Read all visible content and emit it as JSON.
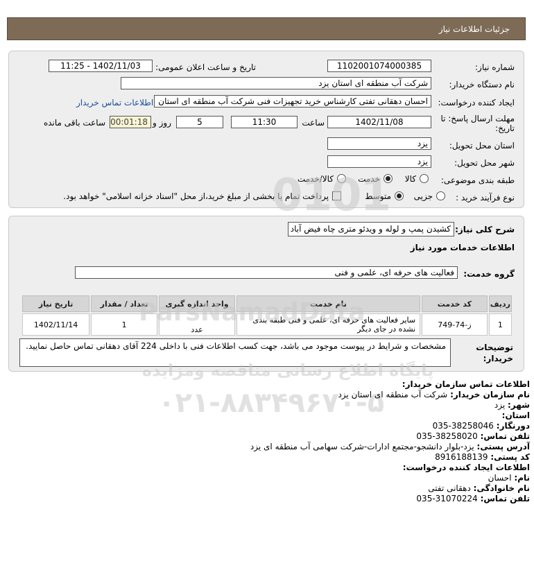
{
  "header": {
    "title": "جزئیات اطلاعات نیاز"
  },
  "need": {
    "number_label": "شماره نیاز:",
    "number": "1102001074000385",
    "announce_label": "تاریخ و ساعت اعلان عمومی:",
    "announce": "1402/11/03 - 11:25",
    "buyer_label": "نام دستگاه خریدار:",
    "buyer": "شرکت آب منطقه ای استان یزد",
    "creator_label": "ایجاد کننده درخواست:",
    "creator": "احسان دهقانی تفتی کارشناس خرید تجهیزات فنی شرکت آب منطقه ای استان",
    "contact_link": "اطلاعات تماس خریدار",
    "deadline_label_1": "مهلت ارسال پاسخ: تا",
    "deadline_label_2": "تاریخ:",
    "deadline_date": "1402/11/08",
    "time_label": "ساعت",
    "deadline_time": "11:30",
    "days": "5",
    "days_label": "روز و",
    "remaining": "00:01:18",
    "remaining_label": "ساعت باقی مانده",
    "province_label": "استان محل تحویل:",
    "province": "یزد",
    "city_label": "شهر محل تحویل:",
    "city": "یزد",
    "category_label": "طبقه بندی موضوعی:",
    "category_options": [
      "کالا",
      "خدمت",
      "کالا/خدمت"
    ],
    "category_selected": "خدمت",
    "process_label": "نوع فرآیند خرید :",
    "process_options": [
      "جزیی",
      "متوسط"
    ],
    "process_selected": "متوسط",
    "payment_note": "پرداخت تمام یا بخشی از مبلغ خرید،از محل \"اسناد خزانه اسلامی\" خواهد بود."
  },
  "summary": {
    "label": "شرح کلی نیاز:",
    "text": "کشیدن پمپ و لوله و ویدئو متری چاه فیض آباد",
    "services_title": "اطلاعات خدمات مورد نیاز",
    "group_label": "گروه خدمت:",
    "group": "فعالیت های حرفه ای، علمی و فنی"
  },
  "table": {
    "headers": [
      "ردیف",
      "کد خدمت",
      "نام خدمت",
      "واحد اندازه گیری",
      "تعداد / مقدار",
      "تاریخ نیاز"
    ],
    "rows": [
      [
        "1",
        "ز-74-749",
        "سایر فعالیت های حرفه ای، علمی و فنی طبقه بندی نشده در جای دیگر",
        "عدد",
        "1",
        "1402/11/14"
      ]
    ]
  },
  "buyer_notes": {
    "label_1": "توضیحات",
    "label_2": "خریدار:",
    "text": "مشخصات و شرایط در پیوست موجود می باشد، جهت کسب اطلاعات فنی با داخلی 224 آقای دهقانی تماس حاصل نمایید."
  },
  "contact": {
    "org_title": "اطلاعات تماس سازمان خریدار:",
    "org_name_label": "نام سازمان خریدار:",
    "org_name": "شرکت آب منطقه ای استان یزد",
    "city_label": "شهر:",
    "city": "یزد",
    "province_label": "استان:",
    "province": "",
    "fax_label": "دورنگار:",
    "fax": "035-38258046",
    "phone_label": "تلفن تماس:",
    "phone": "035-38258020",
    "address_label": "آدرس پستی:",
    "address": "یزد-بلوار دانشجو-مجتمع ادارات-شرکت سهامی آب منطقه ای یزد",
    "postal_label": "کد پستی:",
    "postal": "8916188139",
    "creator_title": "اطلاعات ایجاد کننده درخواست:",
    "first_name_label": "نام:",
    "first_name": "احسان",
    "last_name_label": "نام خانوادگی:",
    "last_name": "دهقانی تفتی",
    "creator_phone_label": "تلفن تماس:",
    "creator_phone": "035-31070224"
  },
  "watermark": {
    "brand": "ParsNamadData",
    "site_line": "پایگاه اطلاع رسانی مناقصه ومزایده",
    "tel": "۰۲۱-۸۸۳۴۹۶۷۰-۵"
  }
}
